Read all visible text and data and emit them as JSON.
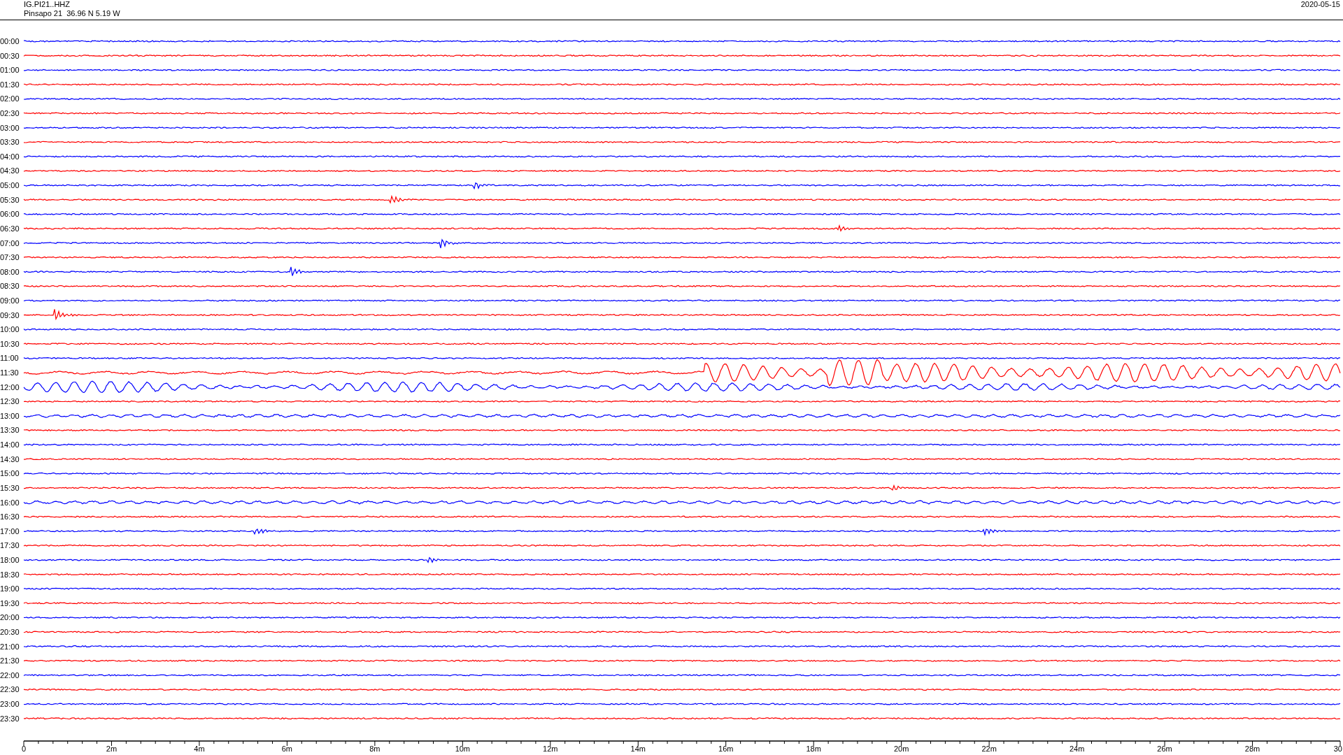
{
  "header": {
    "station": "IG.PI21..HHZ",
    "location": "Pinsapo 21  36.96 N 5.19 W",
    "date": "2020-05-15"
  },
  "rows": [
    {
      "time": "00:00",
      "color": "#0000ff"
    },
    {
      "time": "00:30",
      "color": "#ff0000"
    },
    {
      "time": "01:00",
      "color": "#0000ff"
    },
    {
      "time": "01:30",
      "color": "#ff0000"
    },
    {
      "time": "02:00",
      "color": "#0000ff"
    },
    {
      "time": "02:30",
      "color": "#ff0000"
    },
    {
      "time": "03:00",
      "color": "#0000ff"
    },
    {
      "time": "03:30",
      "color": "#ff0000"
    },
    {
      "time": "04:00",
      "color": "#0000ff"
    },
    {
      "time": "04:30",
      "color": "#ff0000"
    },
    {
      "time": "05:00",
      "color": "#0000ff"
    },
    {
      "time": "05:30",
      "color": "#ff0000"
    },
    {
      "time": "06:00",
      "color": "#0000ff"
    },
    {
      "time": "06:30",
      "color": "#ff0000"
    },
    {
      "time": "07:00",
      "color": "#0000ff"
    },
    {
      "time": "07:30",
      "color": "#ff0000"
    },
    {
      "time": "08:00",
      "color": "#0000ff"
    },
    {
      "time": "08:30",
      "color": "#ff0000"
    },
    {
      "time": "09:00",
      "color": "#0000ff"
    },
    {
      "time": "09:30",
      "color": "#ff0000"
    },
    {
      "time": "10:00",
      "color": "#0000ff"
    },
    {
      "time": "10:30",
      "color": "#ff0000"
    },
    {
      "time": "11:00",
      "color": "#0000ff"
    },
    {
      "time": "11:30",
      "color": "#ff0000"
    },
    {
      "time": "12:00",
      "color": "#0000ff"
    },
    {
      "time": "12:30",
      "color": "#ff0000"
    },
    {
      "time": "13:00",
      "color": "#0000ff"
    },
    {
      "time": "13:30",
      "color": "#ff0000"
    },
    {
      "time": "14:00",
      "color": "#0000ff"
    },
    {
      "time": "14:30",
      "color": "#ff0000"
    },
    {
      "time": "15:00",
      "color": "#0000ff"
    },
    {
      "time": "15:30",
      "color": "#ff0000"
    },
    {
      "time": "16:00",
      "color": "#0000ff"
    },
    {
      "time": "16:30",
      "color": "#ff0000"
    },
    {
      "time": "17:00",
      "color": "#0000ff"
    },
    {
      "time": "17:30",
      "color": "#ff0000"
    },
    {
      "time": "18:00",
      "color": "#0000ff"
    },
    {
      "time": "18:30",
      "color": "#ff0000"
    },
    {
      "time": "19:00",
      "color": "#0000ff"
    },
    {
      "time": "19:30",
      "color": "#ff0000"
    },
    {
      "time": "20:00",
      "color": "#0000ff"
    },
    {
      "time": "20:30",
      "color": "#ff0000"
    },
    {
      "time": "21:00",
      "color": "#0000ff"
    },
    {
      "time": "21:30",
      "color": "#ff0000"
    },
    {
      "time": "22:00",
      "color": "#0000ff"
    },
    {
      "time": "22:30",
      "color": "#ff0000"
    },
    {
      "time": "23:00",
      "color": "#0000ff"
    },
    {
      "time": "23:30",
      "color": "#ff0000"
    }
  ],
  "x_axis": {
    "labels": [
      "0",
      "2m",
      "4m",
      "6m",
      "8m",
      "10m",
      "12m",
      "14m",
      "16m",
      "18m",
      "20m",
      "22m",
      "24m",
      "26m",
      "28m",
      "30"
    ]
  }
}
